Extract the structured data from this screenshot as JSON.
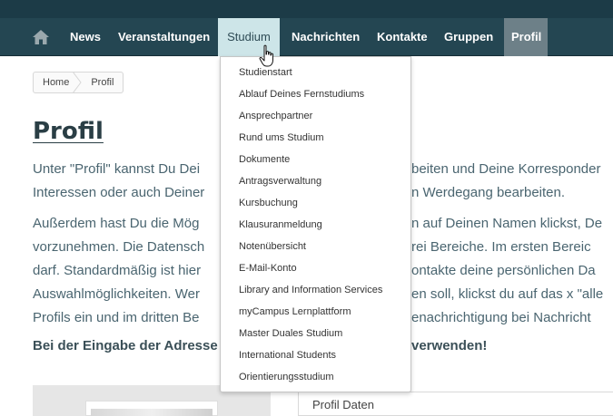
{
  "nav": {
    "items": [
      {
        "label": "News"
      },
      {
        "label": "Veranstaltungen"
      },
      {
        "label": "Studium"
      },
      {
        "label": "Nachrichten"
      },
      {
        "label": "Kontakte"
      },
      {
        "label": "Gruppen"
      },
      {
        "label": "Profil"
      }
    ],
    "home_icon": "home-icon",
    "open_item": "Studium",
    "active_item": "Profil"
  },
  "breadcrumb": [
    "Home",
    "Profil"
  ],
  "page": {
    "title": "Profil",
    "lines": [
      "Unter \"Profil\" kannst Du Dei",
      "beiten und Deine Korresponder",
      "Interessen oder auch Deiner",
      "n Werdegang bearbeiten.",
      "Außerdem hast Du die Mög",
      "n auf Deinen Namen klickst, De",
      "vorzunehmen. Die Datensch",
      "rei Bereiche. Im ersten Bereic",
      "darf. Standardmäßig ist hier",
      "ontakte deine persönlichen Da",
      "Auswahlmöglichkeiten. Wer",
      "en soll, klickst du auf das x \"alle",
      "Profils ein und im dritten Be",
      "enachrichtigung bei Nachricht",
      "Bei der Eingabe der Adresse",
      "verwenden!"
    ],
    "panel_heading": "Profil Daten"
  },
  "dropdown": {
    "items": [
      "Studienstart",
      "Ablauf Deines Fernstudiums",
      "Ansprechpartner",
      "Rund ums Studium",
      "Dokumente",
      "Antragsverwaltung",
      "Kursbuchung",
      "Klausuranmeldung",
      "Notenübersicht",
      "E-Mail-Konto",
      "Library and Information Services",
      "myCampus Lernplattform",
      "Master Duales Studium",
      "International Students",
      "Orientierungsstudium"
    ]
  },
  "colors": {
    "nav_bg": "#244652",
    "top_strip": "#1c3b47",
    "open_tab": "#cde5e8",
    "active_tab": "#6d8088",
    "body_text": "#4a6570"
  }
}
